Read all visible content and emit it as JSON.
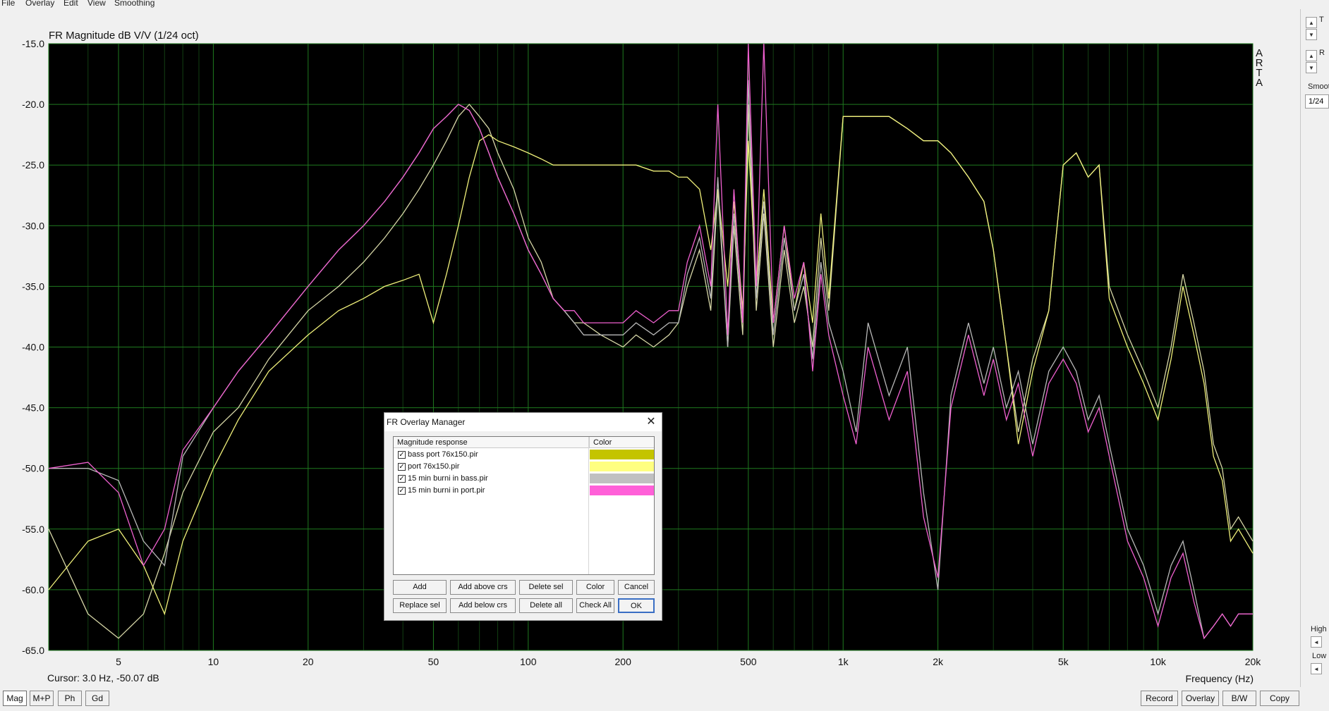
{
  "menu": [
    "File",
    "Overlay",
    "Edit",
    "View",
    "Smoothing"
  ],
  "chart_data": {
    "type": "line",
    "title": "FR Magnitude dB V/V (1/24 oct)",
    "xlabel": "Frequency (Hz)",
    "ylabel": "",
    "xscale": "log",
    "xlim": [
      3,
      20000
    ],
    "ylim": [
      -65,
      -15
    ],
    "xticks": [
      5,
      10,
      20,
      50,
      100,
      200,
      500,
      1000,
      2000,
      5000,
      10000,
      20000
    ],
    "xtick_labels": [
      "5",
      "10",
      "20",
      "50",
      "100",
      "200",
      "500",
      "1k",
      "2k",
      "5k",
      "10k",
      "20k"
    ],
    "yticks": [
      -15,
      -20,
      -25,
      -30,
      -35,
      -40,
      -45,
      -50,
      -55,
      -60,
      -65
    ],
    "ytick_labels": [
      "-15.0",
      "-20.0",
      "-25.0",
      "-30.0",
      "-35.0",
      "-40.0",
      "-45.0",
      "-50.0",
      "-55.0",
      "-60.0",
      "-65.0"
    ],
    "grid": true,
    "background": "#000000",
    "grid_color": "#1f7a1f",
    "logo": "ARTA",
    "cursor_text": "Cursor: 3.0 Hz, -50.07 dB",
    "series": [
      {
        "color": "#d6d6a6",
        "x": [
          3,
          4,
          5,
          6,
          7,
          8,
          10,
          12,
          15,
          20,
          25,
          30,
          35,
          40,
          45,
          50,
          55,
          60,
          65,
          70,
          75,
          80,
          90,
          100,
          110,
          120,
          130,
          140,
          150,
          170,
          200,
          220,
          250,
          280,
          300,
          320,
          350,
          380,
          400,
          430,
          450,
          480,
          500,
          530,
          560,
          600,
          650,
          700,
          750,
          800,
          850,
          900,
          1000,
          1100,
          1200,
          1400,
          1600,
          1800,
          2000,
          2200,
          2500,
          2800,
          3000,
          3300,
          3600,
          4000,
          4500,
          5000,
          5500,
          6000,
          6500,
          7000,
          8000,
          9000,
          10000,
          11000,
          12000,
          13000,
          14000,
          15000,
          16000,
          17000,
          18000,
          20000
        ],
        "y": [
          -55,
          -62,
          -64,
          -62,
          -57,
          -52,
          -47,
          -45,
          -41,
          -37,
          -35,
          -33,
          -31,
          -29,
          -27,
          -25,
          -23,
          -21,
          -20,
          -21,
          -22,
          -24,
          -27,
          -31,
          -33,
          -36,
          -37,
          -38,
          -38,
          -39,
          -40,
          -39,
          -40,
          -39,
          -38,
          -35,
          -32,
          -37,
          -27,
          -40,
          -30,
          -39,
          -20,
          -37,
          -29,
          -40,
          -32,
          -38,
          -35,
          -40,
          -31,
          -37,
          -21,
          -21,
          -21,
          -21,
          -22,
          -23,
          -23,
          -24,
          -26,
          -28,
          -32,
          -40,
          -47,
          -41,
          -37,
          -25,
          -24,
          -26,
          -25,
          -35,
          -39,
          -42,
          -45,
          -40,
          -34,
          -38,
          -42,
          -48,
          -50,
          -55,
          -54,
          -56
        ]
      },
      {
        "color": "#f0f07a",
        "x": [
          3,
          4,
          5,
          6,
          7,
          8,
          10,
          12,
          15,
          20,
          25,
          30,
          35,
          40,
          45,
          50,
          55,
          60,
          65,
          70,
          75,
          80,
          90,
          100,
          110,
          120,
          130,
          140,
          150,
          170,
          200,
          220,
          250,
          280,
          300,
          320,
          350,
          380,
          400,
          430,
          450,
          480,
          500,
          530,
          560,
          600,
          650,
          700,
          750,
          800,
          850,
          900,
          1000,
          1100,
          1200,
          1400,
          1600,
          1800,
          2000,
          2200,
          2500,
          2800,
          3000,
          3300,
          3600,
          4000,
          4500,
          5000,
          5500,
          6000,
          6500,
          7000,
          8000,
          9000,
          10000,
          11000,
          12000,
          13000,
          14000,
          15000,
          16000,
          17000,
          18000,
          20000
        ],
        "y": [
          -60,
          -56,
          -55,
          -58,
          -62,
          -56,
          -50,
          -46,
          -42,
          -39,
          -37,
          -36,
          -35,
          -34.5,
          -34,
          -38,
          -34,
          -30,
          -26,
          -23,
          -22.5,
          -23,
          -23.5,
          -24,
          -24.5,
          -25,
          -25,
          -25,
          -25,
          -25,
          -25,
          -25,
          -25.5,
          -25.5,
          -26,
          -26,
          -27,
          -32,
          -27,
          -35,
          -28,
          -37,
          -23,
          -35,
          -27,
          -38,
          -30,
          -37,
          -33,
          -38,
          -29,
          -36,
          -21,
          -21,
          -21,
          -21,
          -22,
          -23,
          -23,
          -24,
          -26,
          -28,
          -32,
          -40,
          -48,
          -42,
          -37,
          -25,
          -24,
          -26,
          -25,
          -36,
          -40,
          -43,
          -46,
          -41,
          -35,
          -39,
          -43,
          -49,
          -51,
          -56,
          -55,
          -57
        ]
      },
      {
        "color": "#b8b8b8",
        "x": [
          3,
          4,
          5,
          6,
          7,
          8,
          10,
          12,
          15,
          20,
          25,
          30,
          35,
          40,
          45,
          50,
          55,
          60,
          65,
          70,
          75,
          80,
          90,
          100,
          110,
          120,
          130,
          140,
          150,
          170,
          200,
          220,
          250,
          280,
          300,
          320,
          350,
          380,
          400,
          430,
          450,
          480,
          500,
          530,
          560,
          600,
          650,
          700,
          750,
          800,
          850,
          900,
          1000,
          1100,
          1200,
          1400,
          1600,
          1800,
          2000,
          2200,
          2500,
          2800,
          3000,
          3300,
          3600,
          4000,
          4500,
          5000,
          5500,
          6000,
          6500,
          7000,
          8000,
          9000,
          10000,
          11000,
          12000,
          13000,
          14000,
          15000,
          16000,
          17000,
          18000,
          20000
        ],
        "y": [
          -50,
          -50,
          -51,
          -56,
          -58,
          -49,
          -45,
          -42,
          -39,
          -35,
          -32,
          -30,
          -28,
          -26,
          -24,
          -22,
          -21,
          -20,
          -20.5,
          -22,
          -24,
          -26,
          -29,
          -32,
          -34,
          -36,
          -37,
          -38,
          -39,
          -39,
          -39,
          -38,
          -39,
          -38,
          -38,
          -34,
          -31,
          -36,
          -26,
          -40,
          -29,
          -38,
          -18,
          -36,
          -28,
          -39,
          -31,
          -37,
          -34,
          -41,
          -33,
          -38,
          -42,
          -47,
          -38,
          -44,
          -40,
          -52,
          -60,
          -44,
          -38,
          -43,
          -40,
          -45,
          -42,
          -48,
          -42,
          -40,
          -42,
          -46,
          -44,
          -48,
          -55,
          -58,
          -62,
          -58,
          -56,
          -60,
          -64,
          -63,
          -62,
          -63,
          -62,
          -62
        ]
      },
      {
        "color": "#f060d0",
        "x": [
          3,
          4,
          5,
          6,
          7,
          8,
          10,
          12,
          15,
          20,
          25,
          30,
          35,
          40,
          45,
          50,
          55,
          60,
          65,
          70,
          75,
          80,
          90,
          100,
          110,
          120,
          130,
          140,
          150,
          170,
          200,
          220,
          250,
          280,
          300,
          320,
          350,
          380,
          400,
          430,
          450,
          480,
          500,
          530,
          560,
          600,
          650,
          700,
          750,
          800,
          850,
          900,
          1000,
          1100,
          1200,
          1400,
          1600,
          1800,
          2000,
          2200,
          2500,
          2800,
          3000,
          3300,
          3600,
          4000,
          4500,
          5000,
          5500,
          6000,
          6500,
          7000,
          8000,
          9000,
          10000,
          11000,
          12000,
          13000,
          14000,
          15000,
          16000,
          17000,
          18000,
          20000
        ],
        "y": [
          -50,
          -49.5,
          -52,
          -58,
          -55,
          -48.5,
          -45,
          -42,
          -39,
          -35,
          -32,
          -30,
          -28,
          -26,
          -24,
          -22,
          -21,
          -20,
          -20.5,
          -22,
          -24,
          -26,
          -29,
          -32,
          -34,
          -36,
          -37,
          -37,
          -38,
          -38,
          -38,
          -37,
          -38,
          -37,
          -37,
          -33,
          -30,
          -35,
          -20,
          -39,
          -27,
          -38,
          -15,
          -35,
          -15,
          -38,
          -30,
          -36,
          -33,
          -42,
          -34,
          -39,
          -44,
          -48,
          -40,
          -46,
          -42,
          -54,
          -59,
          -45,
          -39,
          -44,
          -41,
          -46,
          -43,
          -49,
          -43,
          -41,
          -43,
          -47,
          -45,
          -49,
          -56,
          -59,
          -63,
          -59,
          -57,
          -61,
          -64,
          -63,
          -62,
          -63,
          -62,
          -62
        ]
      }
    ]
  },
  "right_panel": {
    "label1": "T",
    "label2": "R",
    "smooth_label": "Smooth",
    "smooth_value": "1/24",
    "high_label": "High",
    "low_label": "Low",
    "up_glyph": "▲",
    "down_glyph": "▼",
    "left_glyph": "◄"
  },
  "bottom_left": [
    "Mag",
    "M+P",
    "Ph",
    "Gd"
  ],
  "bottom_right": [
    "Record",
    "Overlay",
    "B/W",
    "Copy"
  ],
  "dialog": {
    "title": "FR Overlay Manager",
    "close_glyph": "✕",
    "col_response": "Magnitude response",
    "col_color": "Color",
    "check_glyph": "✓",
    "rows": [
      {
        "label": "bass port 76x150.pir",
        "color": "#c4c400"
      },
      {
        "label": "port 76x150.pir",
        "color": "#ffff80"
      },
      {
        "label": "15 min burni in bass.pir",
        "color": "#c0c0c0"
      },
      {
        "label": "15 min burni in port.pir",
        "color": "#ff60d8"
      }
    ],
    "buttons": {
      "add": "Add",
      "add_above": "Add above crs",
      "delete_sel": "Delete sel",
      "color": "Color",
      "cancel": "Cancel",
      "replace_sel": "Replace sel",
      "add_below": "Add below crs",
      "delete_all": "Delete all",
      "check_all": "Check All",
      "ok": "OK"
    }
  }
}
